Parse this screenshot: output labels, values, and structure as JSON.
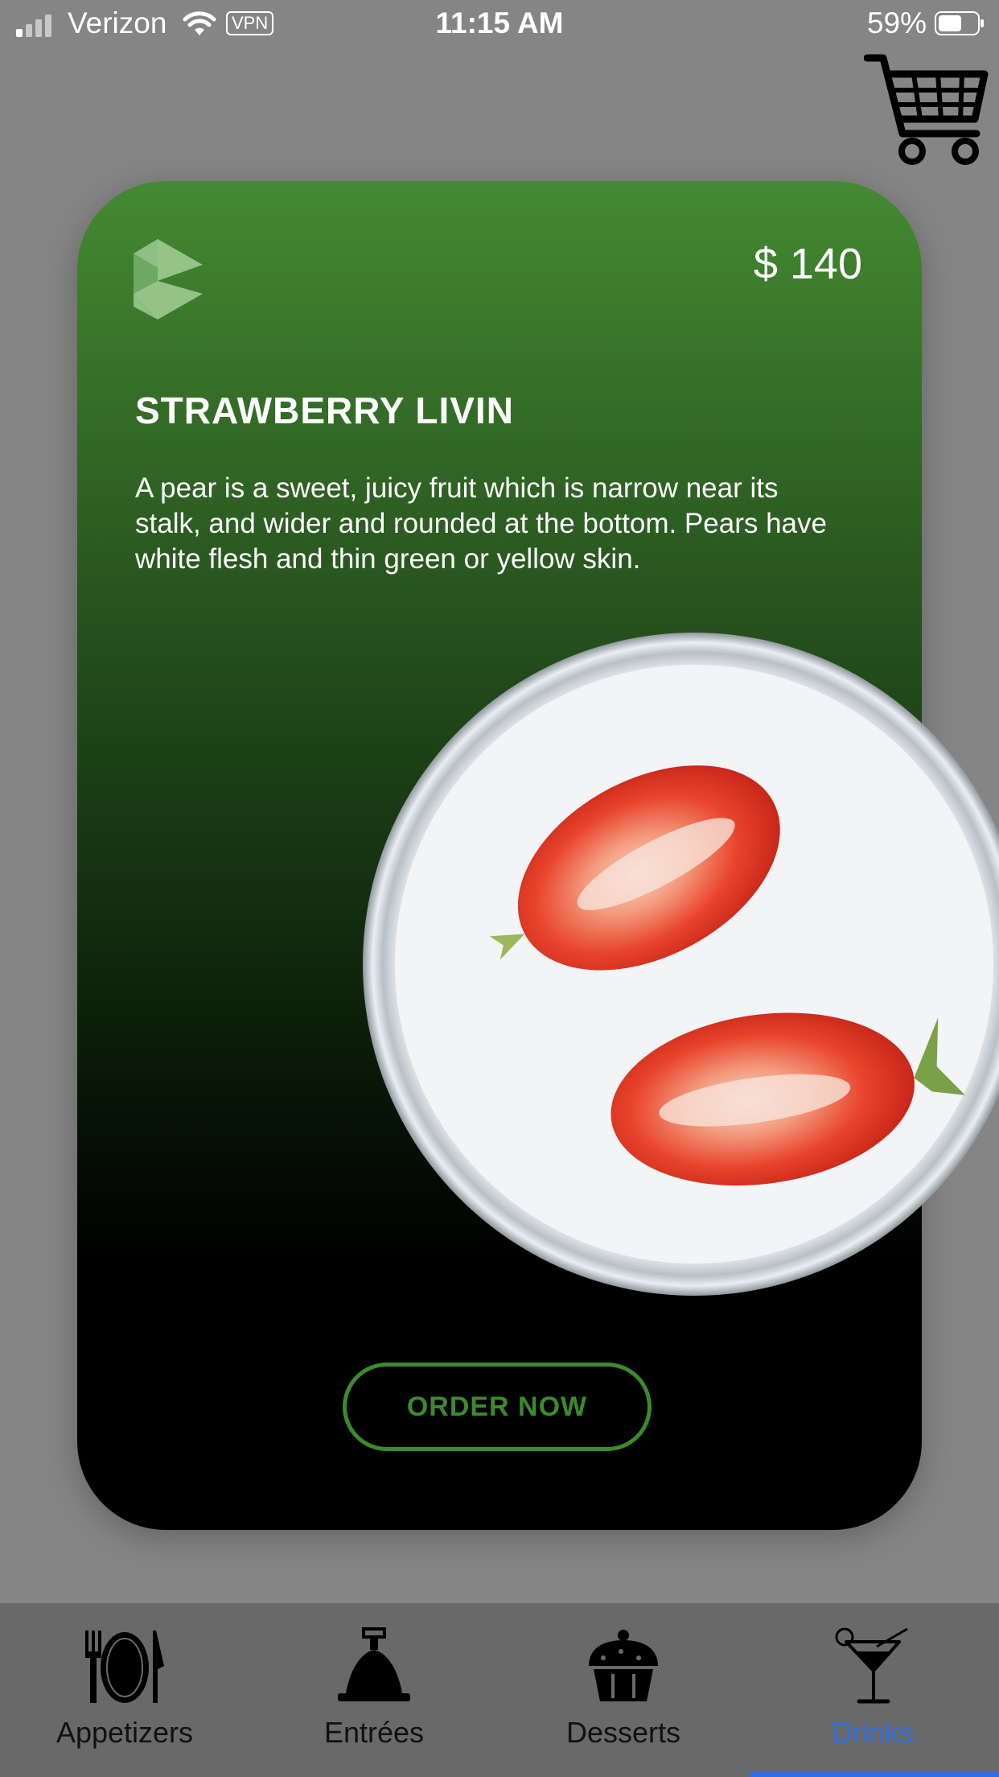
{
  "status_bar": {
    "carrier": "Verizon",
    "vpn": "VPN",
    "time": "11:15 AM",
    "battery": "59%"
  },
  "header": {
    "cart_icon": "shopping-cart-icon"
  },
  "product": {
    "price": "$ 140",
    "name": "STRAWBERRY LIVIN",
    "description": "A pear is a sweet, juicy fruit which is narrow near its stalk, and wider and rounded at the bottom. Pears have white flesh and thin green or yellow skin.",
    "order_label": "ORDER NOW"
  },
  "tabs": [
    {
      "label": "Appetizers",
      "icon": "plate-fork-knife-icon"
    },
    {
      "label": "Entrées",
      "icon": "cloche-icon"
    },
    {
      "label": "Desserts",
      "icon": "cupcake-icon"
    },
    {
      "label": "Drinks",
      "icon": "cocktail-icon",
      "active": true
    }
  ],
  "colors": {
    "accent": "#3d8a2c",
    "active_tab": "#2f6fe0",
    "background": "#858585"
  }
}
